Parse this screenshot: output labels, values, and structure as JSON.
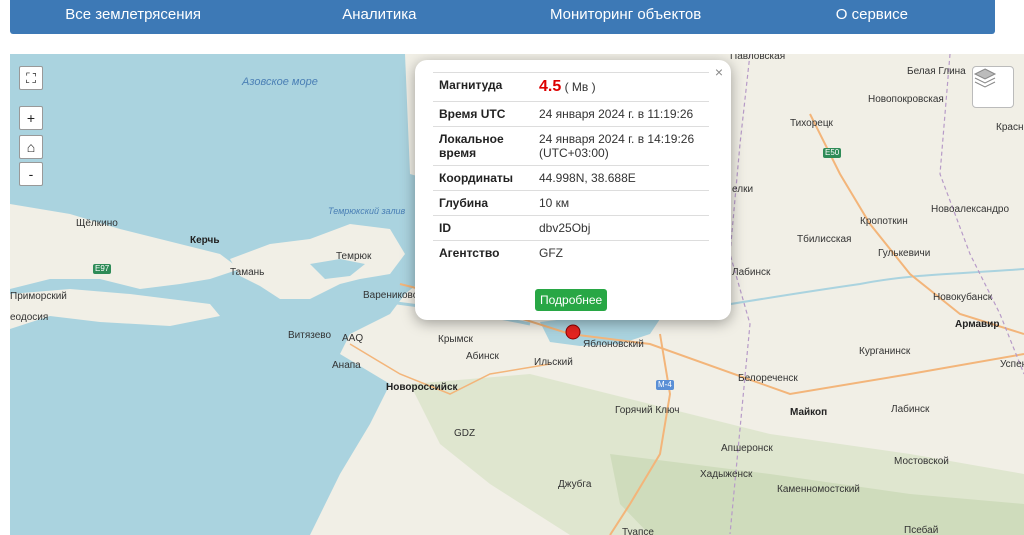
{
  "nav": {
    "items": [
      "Все землетрясения",
      "Аналитика",
      "Мониторинг объектов",
      "О сервисе"
    ]
  },
  "controls": {
    "fullscreen_icon": "fullscreen-icon",
    "zoom_in": "+",
    "home_icon": "home-icon",
    "zoom_out": "-",
    "layers_icon": "layers-icon"
  },
  "popup": {
    "close": "×",
    "rows": {
      "magnitude_label": "Магнитуда",
      "magnitude_value": "4.5",
      "magnitude_type": "( Mв )",
      "time_utc_label": "Время UTC",
      "time_utc_value": "24 января 2024 г. в 11:19:26",
      "local_time_label": "Локальное время",
      "local_time_value": "24 января 2024 г. в 14:19:26 (UTC+03:00)",
      "coords_label": "Координаты",
      "coords_value": "44.998N, 38.688E",
      "depth_label": "Глубина",
      "depth_value": "10 км",
      "id_label": "ID",
      "id_value": "dbv25Obj",
      "agency_label": "Агентство",
      "agency_value": "GFZ"
    },
    "more_button": "Подробнее"
  },
  "map_labels": {
    "azov_sea": "Азовское море",
    "temryuk_bay": "Темрюкский залив",
    "shchelkino": "Щёлкино",
    "kerch": "Керчь",
    "taman": "Тамань",
    "temryuk": "Темрюк",
    "primorsky": "Приморский",
    "feodosia": "еодосия",
    "varenikovskaya": "Варениковск",
    "vityazevo": "Витязево",
    "aaq": "AAQ",
    "anapa": "Анапа",
    "krymsk": "Крымск",
    "abinsk": "Абинск",
    "ilsky": "Ильский",
    "novorossiysk": "Новороссийск",
    "gdz": "GDZ",
    "yablonovsky": "Яблоновский",
    "goryachy_klyuch": "Горячий Ключ",
    "dzhubga": "Джубга",
    "tuapse": "Туапсе",
    "pavlovskaya": "Павловская",
    "belaya_glina": "Белая Глина",
    "novopokrovskaya": "Новопокровская",
    "tikhoretsk": "Тихорецк",
    "krasn": "Красн",
    "kropotkin": "Кропоткин",
    "novoaleksandrovsk": "Новоалександро",
    "tbilisskaya": "Тбилисская",
    "gulkevichi": "Гулькевичи",
    "labinsk_top": "Лабинск",
    "novokubansk": "Новокубанск",
    "armavir": "Армавир",
    "kurganinsk": "Курганинск",
    "uspen": "Успен",
    "belorechensk": "Белореченск",
    "maykop": "Майкоп",
    "labinsk": "Лабинск",
    "apsheronsk": "Апшеронск",
    "khadyzhensk": "Хадыженск",
    "mostovskoy": "Мостовской",
    "kamennomostsky": "Каменномостский",
    "psebay": "Псебай",
    "elki": "елки"
  },
  "roads": {
    "e97": "E97",
    "e50": "E50",
    "m4": "M-4"
  }
}
